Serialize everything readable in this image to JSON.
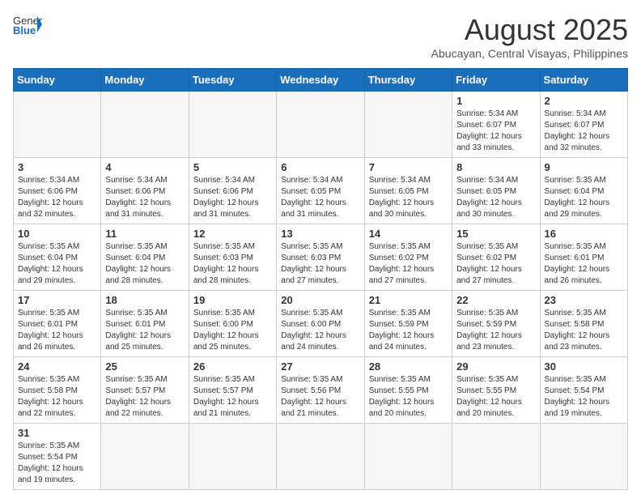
{
  "header": {
    "logo_general": "General",
    "logo_blue": "Blue",
    "title": "August 2025",
    "subtitle": "Abucayan, Central Visayas, Philippines"
  },
  "weekdays": [
    "Sunday",
    "Monday",
    "Tuesday",
    "Wednesday",
    "Thursday",
    "Friday",
    "Saturday"
  ],
  "days": [
    {
      "date": "",
      "info": ""
    },
    {
      "date": "",
      "info": ""
    },
    {
      "date": "",
      "info": ""
    },
    {
      "date": "",
      "info": ""
    },
    {
      "date": "",
      "info": ""
    },
    {
      "date": "1",
      "info": "Sunrise: 5:34 AM\nSunset: 6:07 PM\nDaylight: 12 hours\nand 33 minutes."
    },
    {
      "date": "2",
      "info": "Sunrise: 5:34 AM\nSunset: 6:07 PM\nDaylight: 12 hours\nand 32 minutes."
    },
    {
      "date": "3",
      "info": "Sunrise: 5:34 AM\nSunset: 6:06 PM\nDaylight: 12 hours\nand 32 minutes."
    },
    {
      "date": "4",
      "info": "Sunrise: 5:34 AM\nSunset: 6:06 PM\nDaylight: 12 hours\nand 31 minutes."
    },
    {
      "date": "5",
      "info": "Sunrise: 5:34 AM\nSunset: 6:06 PM\nDaylight: 12 hours\nand 31 minutes."
    },
    {
      "date": "6",
      "info": "Sunrise: 5:34 AM\nSunset: 6:05 PM\nDaylight: 12 hours\nand 31 minutes."
    },
    {
      "date": "7",
      "info": "Sunrise: 5:34 AM\nSunset: 6:05 PM\nDaylight: 12 hours\nand 30 minutes."
    },
    {
      "date": "8",
      "info": "Sunrise: 5:34 AM\nSunset: 6:05 PM\nDaylight: 12 hours\nand 30 minutes."
    },
    {
      "date": "9",
      "info": "Sunrise: 5:35 AM\nSunset: 6:04 PM\nDaylight: 12 hours\nand 29 minutes."
    },
    {
      "date": "10",
      "info": "Sunrise: 5:35 AM\nSunset: 6:04 PM\nDaylight: 12 hours\nand 29 minutes."
    },
    {
      "date": "11",
      "info": "Sunrise: 5:35 AM\nSunset: 6:04 PM\nDaylight: 12 hours\nand 28 minutes."
    },
    {
      "date": "12",
      "info": "Sunrise: 5:35 AM\nSunset: 6:03 PM\nDaylight: 12 hours\nand 28 minutes."
    },
    {
      "date": "13",
      "info": "Sunrise: 5:35 AM\nSunset: 6:03 PM\nDaylight: 12 hours\nand 27 minutes."
    },
    {
      "date": "14",
      "info": "Sunrise: 5:35 AM\nSunset: 6:02 PM\nDaylight: 12 hours\nand 27 minutes."
    },
    {
      "date": "15",
      "info": "Sunrise: 5:35 AM\nSunset: 6:02 PM\nDaylight: 12 hours\nand 27 minutes."
    },
    {
      "date": "16",
      "info": "Sunrise: 5:35 AM\nSunset: 6:01 PM\nDaylight: 12 hours\nand 26 minutes."
    },
    {
      "date": "17",
      "info": "Sunrise: 5:35 AM\nSunset: 6:01 PM\nDaylight: 12 hours\nand 26 minutes."
    },
    {
      "date": "18",
      "info": "Sunrise: 5:35 AM\nSunset: 6:01 PM\nDaylight: 12 hours\nand 25 minutes."
    },
    {
      "date": "19",
      "info": "Sunrise: 5:35 AM\nSunset: 6:00 PM\nDaylight: 12 hours\nand 25 minutes."
    },
    {
      "date": "20",
      "info": "Sunrise: 5:35 AM\nSunset: 6:00 PM\nDaylight: 12 hours\nand 24 minutes."
    },
    {
      "date": "21",
      "info": "Sunrise: 5:35 AM\nSunset: 5:59 PM\nDaylight: 12 hours\nand 24 minutes."
    },
    {
      "date": "22",
      "info": "Sunrise: 5:35 AM\nSunset: 5:59 PM\nDaylight: 12 hours\nand 23 minutes."
    },
    {
      "date": "23",
      "info": "Sunrise: 5:35 AM\nSunset: 5:58 PM\nDaylight: 12 hours\nand 23 minutes."
    },
    {
      "date": "24",
      "info": "Sunrise: 5:35 AM\nSunset: 5:58 PM\nDaylight: 12 hours\nand 22 minutes."
    },
    {
      "date": "25",
      "info": "Sunrise: 5:35 AM\nSunset: 5:57 PM\nDaylight: 12 hours\nand 22 minutes."
    },
    {
      "date": "26",
      "info": "Sunrise: 5:35 AM\nSunset: 5:57 PM\nDaylight: 12 hours\nand 21 minutes."
    },
    {
      "date": "27",
      "info": "Sunrise: 5:35 AM\nSunset: 5:56 PM\nDaylight: 12 hours\nand 21 minutes."
    },
    {
      "date": "28",
      "info": "Sunrise: 5:35 AM\nSunset: 5:55 PM\nDaylight: 12 hours\nand 20 minutes."
    },
    {
      "date": "29",
      "info": "Sunrise: 5:35 AM\nSunset: 5:55 PM\nDaylight: 12 hours\nand 20 minutes."
    },
    {
      "date": "30",
      "info": "Sunrise: 5:35 AM\nSunset: 5:54 PM\nDaylight: 12 hours\nand 19 minutes."
    },
    {
      "date": "31",
      "info": "Sunrise: 5:35 AM\nSunset: 5:54 PM\nDaylight: 12 hours\nand 19 minutes."
    }
  ]
}
